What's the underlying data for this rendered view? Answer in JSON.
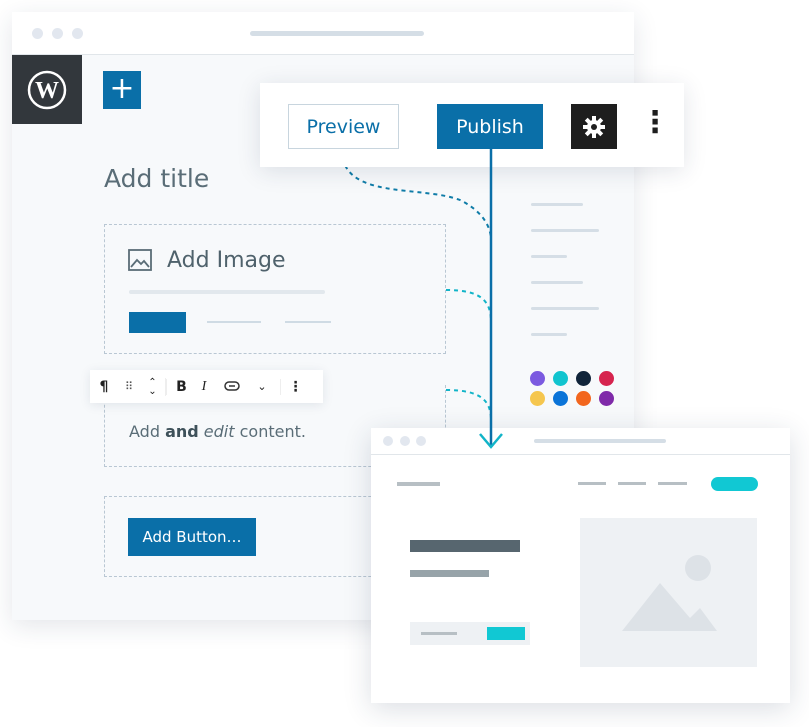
{
  "editor": {
    "logo": "WordPress",
    "add_block": "+",
    "title_placeholder": "Add title",
    "image_block": {
      "label": "Add Image",
      "icon": "image-icon"
    },
    "paragraph_block": {
      "before": "Add ",
      "bold": "and",
      "space": " ",
      "italic": "edit",
      "after": " content."
    },
    "button_block": {
      "label": "Add Button…"
    },
    "block_toolbar": {
      "paragraph": "¶",
      "drag": "⠿",
      "move": "⌃⌄",
      "bold": "B",
      "italic": "I",
      "link": "link-icon",
      "more": "⌄",
      "options": "⋮"
    },
    "palette": [
      "#7b5ae0",
      "#11c4cf",
      "#10243a",
      "#d6244e",
      "#f5c64e",
      "#0b74d8",
      "#f2661e",
      "#7f2aa9"
    ]
  },
  "header_toolbar": {
    "preview_label": "Preview",
    "publish_label": "Publish",
    "settings_icon": "gear-icon",
    "more_icon": "⋮"
  },
  "colors": {
    "primary": "#0a6fa8",
    "accent": "#11c4cf",
    "dark": "#32373c"
  }
}
